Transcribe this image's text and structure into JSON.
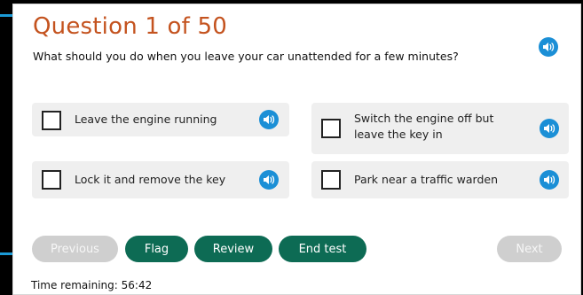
{
  "question": {
    "title": "Question 1 of 50",
    "text": "What should you do when you leave your car unattended for a few minutes?",
    "audio_icon": "speaker-icon"
  },
  "answers": [
    {
      "label_line1": "Leave the engine running",
      "label_line2": ""
    },
    {
      "label_line1": "Switch the engine off but",
      "label_line2": "leave the key in"
    },
    {
      "label_line1": "Lock it and remove the key",
      "label_line2": ""
    },
    {
      "label_line1": "Park near a traffic warden",
      "label_line2": ""
    }
  ],
  "nav": {
    "previous": "Previous",
    "flag": "Flag",
    "review": "Review",
    "end_test": "End test",
    "next": "Next"
  },
  "time": {
    "label": "Time remaining:",
    "value": "56:42"
  },
  "colors": {
    "title": "#c4531f",
    "accent_blue": "#1b8fd6",
    "button_green": "#0d6b54",
    "button_disabled": "#cfcfcf",
    "answer_bg": "#efefef"
  }
}
